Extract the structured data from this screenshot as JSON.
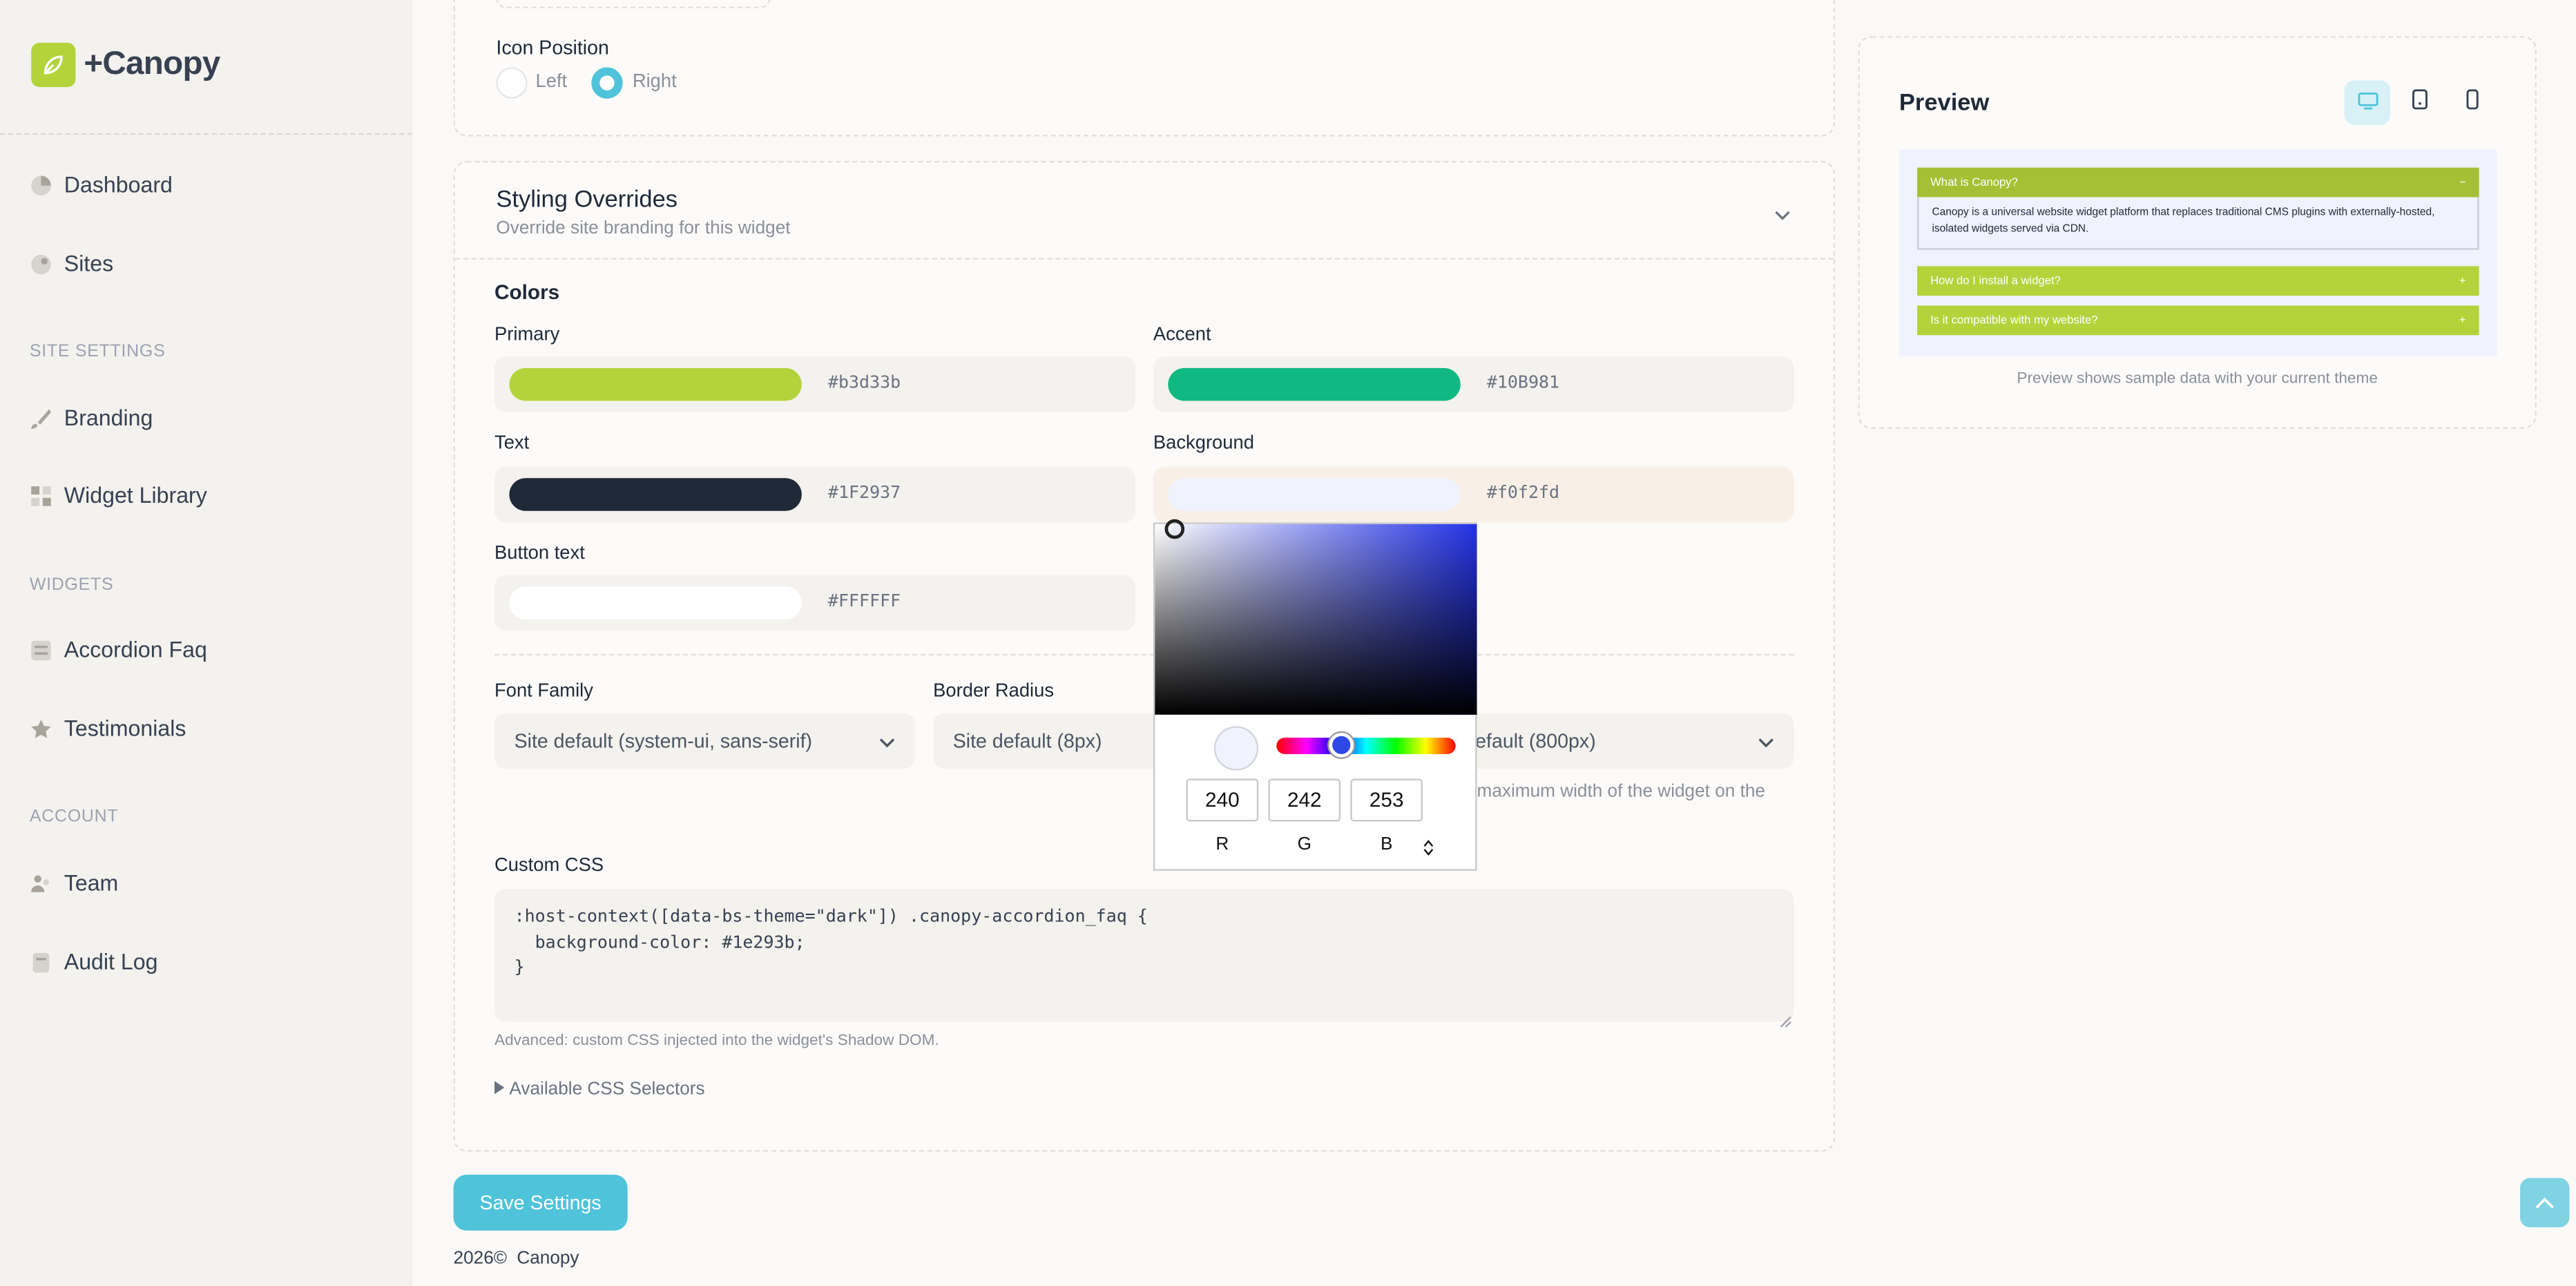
{
  "brand": {
    "name": "+Canopy"
  },
  "sidebar": {
    "items": [
      {
        "label": "Dashboard",
        "icon": "chart-pie-icon"
      },
      {
        "label": "Sites",
        "icon": "globe-icon"
      }
    ],
    "sections": [
      {
        "title": "SITE SETTINGS",
        "items": [
          {
            "label": "Branding",
            "icon": "brush-icon"
          },
          {
            "label": "Widget Library",
            "icon": "grid-icon"
          }
        ]
      },
      {
        "title": "WIDGETS",
        "items": [
          {
            "label": "Accordion Faq",
            "icon": "list-icon"
          },
          {
            "label": "Testimonials",
            "icon": "star-icon"
          }
        ]
      },
      {
        "title": "ACCOUNT",
        "items": [
          {
            "label": "Team",
            "icon": "users-icon"
          },
          {
            "label": "Audit Log",
            "icon": "document-icon"
          }
        ]
      }
    ]
  },
  "icon_position": {
    "label": "Icon Position",
    "options": [
      {
        "label": "Left",
        "selected": false
      },
      {
        "label": "Right",
        "selected": true
      }
    ]
  },
  "styling": {
    "title": "Styling Overrides",
    "subtitle": "Override site branding for this widget",
    "colors_heading": "Colors",
    "colors": [
      {
        "label": "Primary",
        "hex": "#b3d33b",
        "swatch": "#b3d33b"
      },
      {
        "label": "Accent",
        "hex": "#10B981",
        "swatch": "#10b981"
      },
      {
        "label": "Text",
        "hex": "#1F2937",
        "swatch": "#1f2937"
      },
      {
        "label": "Background",
        "hex": "#f0f2fd",
        "swatch": "#f0f2fd"
      },
      {
        "label": "Button text",
        "hex": "#FFFFFF",
        "swatch": "#ffffff"
      }
    ],
    "font_family": {
      "label": "Font Family",
      "value": "Site default (system-ui, sans-serif)"
    },
    "border_radius": {
      "label": "Border Radius",
      "value": "Site default (8px)"
    },
    "max_width": {
      "value": "efault (800px)",
      "help": "maximum width of the widget on the"
    },
    "custom_css": {
      "label": "Custom CSS",
      "value": ":host-context([data-bs-theme=\"dark\"]) .canopy-accordion_faq {\n  background-color: #1e293b;\n}",
      "help": "Advanced: custom CSS injected into the widget's Shadow DOM."
    },
    "selectors_toggle": "Available CSS Selectors"
  },
  "color_picker": {
    "r": "240",
    "g": "242",
    "b": "253",
    "r_label": "R",
    "g_label": "G",
    "b_label": "B"
  },
  "save_label": "Save Settings",
  "footer": {
    "year": "2026©",
    "name": "Canopy"
  },
  "preview": {
    "title": "Preview",
    "note": "Preview shows sample data with your current theme",
    "faq": [
      {
        "q": "What is Canopy?",
        "a": "Canopy is a universal website widget platform that replaces traditional CMS plugins with externally-hosted, isolated widgets served via CDN.",
        "toggle": "−"
      },
      {
        "q": "How do I install a widget?",
        "toggle": "+"
      },
      {
        "q": "Is it compatible with my website?",
        "toggle": "+"
      }
    ]
  },
  "theme": {
    "accent": "#4fc3d9",
    "brand": "#b3d33b",
    "faq_head_open": "#a5c034"
  }
}
